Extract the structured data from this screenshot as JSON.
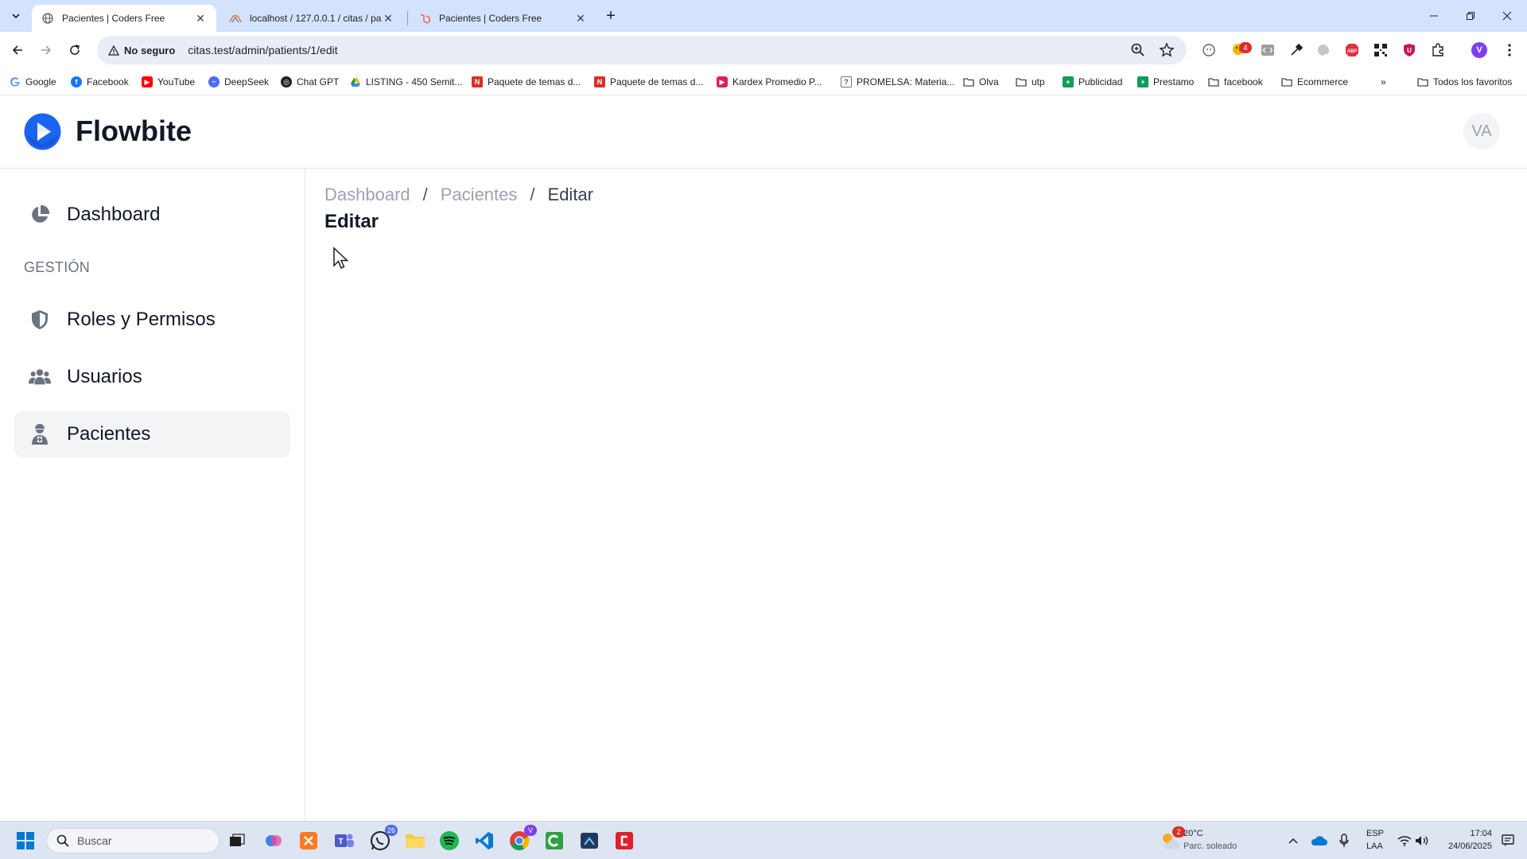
{
  "browser": {
    "tabs": [
      {
        "title": "Pacientes | Coders Free",
        "active": true
      },
      {
        "title": "localhost / 127.0.0.1 / citas / pa",
        "active": false
      },
      {
        "title": "Pacientes | Coders Free",
        "active": false
      }
    ],
    "security_label": "No seguro",
    "url": "citas.test/admin/patients/1/edit",
    "bookmarks": [
      {
        "label": "Google"
      },
      {
        "label": "Facebook"
      },
      {
        "label": "YouTube"
      },
      {
        "label": "DeepSeek"
      },
      {
        "label": "Chat GPT"
      },
      {
        "label": "LISTING - 450 Semit..."
      },
      {
        "label": "Paquete de temas d..."
      },
      {
        "label": "Paquete de temas d..."
      },
      {
        "label": "Kardex Promedio P..."
      },
      {
        "label": "PROMELSA: Materia..."
      },
      {
        "label": "Olva"
      },
      {
        "label": "utp"
      },
      {
        "label": "Publicidad"
      },
      {
        "label": "Prestamo"
      },
      {
        "label": "facebook"
      },
      {
        "label": "Ecommerce"
      }
    ],
    "all_bookmarks_label": "Todos los favoritos",
    "extension_badge": "4",
    "profile_initial": "V"
  },
  "app": {
    "brand": "Flowbite",
    "avatar_initials": "VA",
    "sidebar": {
      "section_label": "GESTIÓN",
      "items": [
        {
          "label": "Dashboard",
          "icon": "pie-chart-icon"
        },
        {
          "label": "Roles y Permisos",
          "icon": "shield-icon"
        },
        {
          "label": "Usuarios",
          "icon": "users-icon"
        },
        {
          "label": "Pacientes",
          "icon": "patient-icon",
          "active": true
        }
      ]
    },
    "breadcrumb": [
      "Dashboard",
      "Pacientes",
      "Editar"
    ],
    "page_title": "Editar"
  },
  "taskbar": {
    "search_placeholder": "Buscar",
    "whatsapp_badge": "26",
    "weather_badge": "2",
    "temperature": "20°C",
    "weather": "Parc. soleado",
    "lang_top": "ESP",
    "lang_bottom": "LAA",
    "time": "17:04",
    "date": "24/06/2025"
  },
  "colors": {
    "tabbar_bg": "#d3e3fd",
    "brand_blue": "#1c64f2",
    "sidebar_active_bg": "#f3f4f6",
    "icon_gray": "#6b7280"
  }
}
